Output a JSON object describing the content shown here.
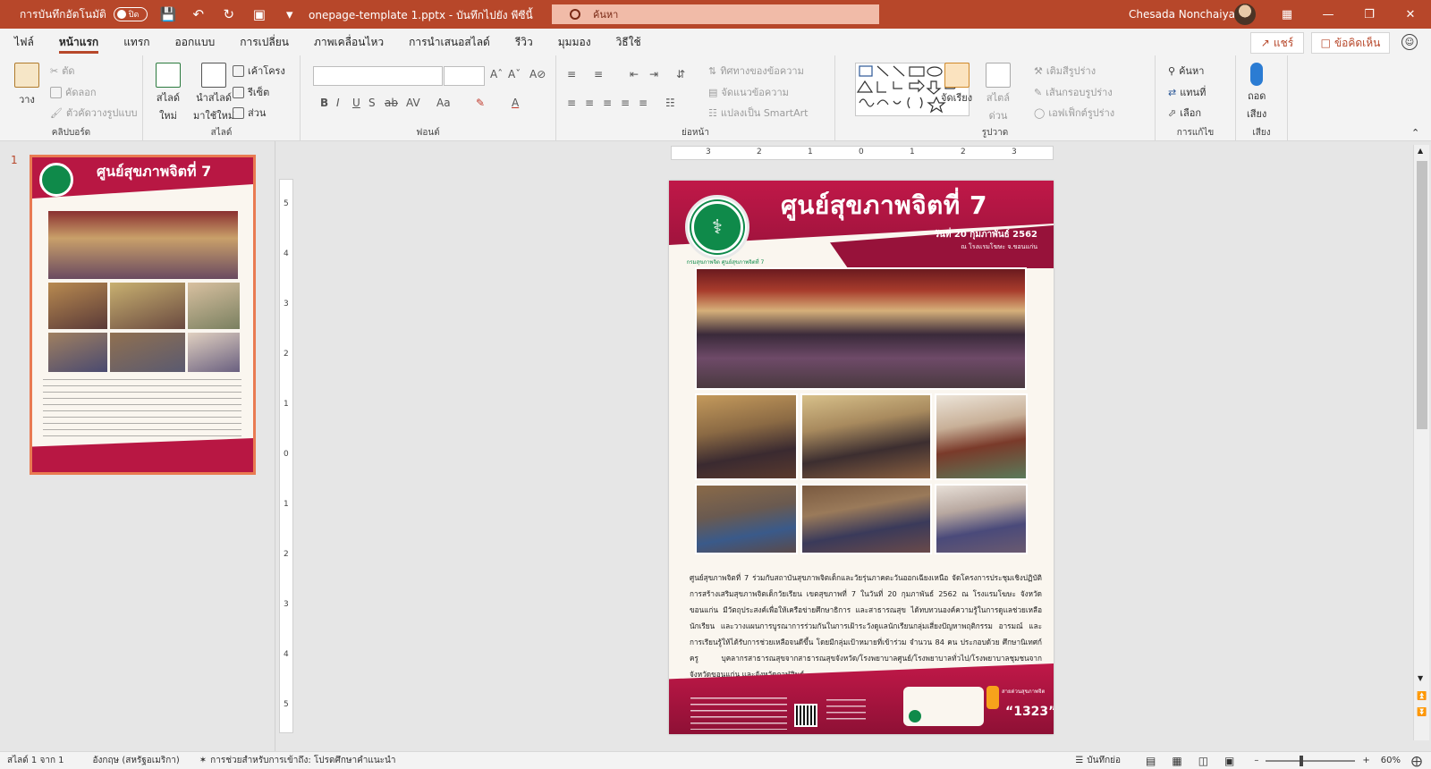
{
  "titlebar": {
    "autosave_label": "การบันทึกอัตโนมัติ",
    "autosave_state": "ปิด",
    "doc_title": "onepage-template 1.pptx - บันทึกไปยัง พีซีนี้",
    "search_placeholder": "ค้นหา",
    "user_name": "Chesada Nonchaiya"
  },
  "tabs": [
    "ไฟล์",
    "หน้าแรก",
    "แทรก",
    "ออกแบบ",
    "การเปลี่ยน",
    "ภาพเคลื่อนไหว",
    "การนำเสนอสไลด์",
    "รีวิว",
    "มุมมอง",
    "วิธีใช้"
  ],
  "active_tab": "หน้าแรก",
  "share_label": "แชร์",
  "comments_label": "ข้อคิดเห็น",
  "ribbon": {
    "clipboard": {
      "paste": "วาง",
      "cut": "ตัด",
      "copy": "คัดลอก",
      "format_painter": "ตัวคัดวางรูปแบบ",
      "label": "คลิปบอร์ด"
    },
    "slides": {
      "new_slide": "สไลด์",
      "new_slide_sub": "ใหม่",
      "reuse": "นำสไลด์",
      "reuse_sub": "มาใช้ใหม่",
      "layout": "เค้าโครง",
      "reset": "รีเซ็ต",
      "section": "ส่วน",
      "label": "สไลด์"
    },
    "font": {
      "label": "ฟอนต์",
      "case": "Aa"
    },
    "paragraph": {
      "label": "ย่อหน้า",
      "text_direction": "ทิศทางของข้อความ",
      "align_text": "จัดแนวข้อความ",
      "smartart": "แปลงเป็น SmartArt"
    },
    "drawing": {
      "arrange": "จัดเรียง",
      "quick_styles": "สไตล์",
      "quick_styles_sub": "ด่วน",
      "fill": "เติมสีรูปร่าง",
      "outline": "เส้นกรอบรูปร่าง",
      "effects": "เอฟเฟ็กต์รูปร่าง",
      "label": "รูปวาด"
    },
    "editing": {
      "find": "ค้นหา",
      "replace": "แทนที่",
      "select": "เลือก",
      "label": "การแก้ไข"
    },
    "voice": {
      "dictate": "ถอด",
      "dictate_sub": "เสียง",
      "label": "เสียง"
    }
  },
  "slide_pane": {
    "slide_number": "1"
  },
  "ruler": {
    "h_ticks": [
      "3",
      "2",
      "1",
      "0",
      "1",
      "2",
      "3"
    ],
    "v_ticks": [
      "5",
      "4",
      "3",
      "2",
      "1",
      "0",
      "1",
      "2",
      "3",
      "4",
      "5"
    ]
  },
  "slide": {
    "title": "ศูนย์สุขภาพจิตที่ 7",
    "date": "วันที่ 20 กุมภาพันธ์ 2562",
    "venue": "ณ โรงแรมโฆษะ จ.ขอนแก่น",
    "logo_caption": "กรมสุขภาพจิต ศูนย์สุขภาพจิตที่ 7 ขอนแก่น",
    "body": "ศูนย์สุขภาพจิตที่ 7 ร่วมกับสถาบันสุขภาพจิตเด็กและวัยรุ่นภาคตะวันออกเฉียงเหนือ จัดโครงการประชุมเชิงปฏิบัติการสร้างเสริมสุขภาพจิตเด็กวัยเรียน เขตสุขภาพที่ 7 ในวันที่ 20 กุมภาพันธ์ 2562 ณ โรงแรมโฆษะ จังหวัดขอนแก่น มีวัตถุประสงค์เพื่อให้เครือข่ายศึกษาธิการ และสาธารณสุข ได้ทบทวนองค์ความรู้ในการดูแลช่วยเหลือนักเรียน และวางแผนการบูรณาการร่วมกันในการเฝ้าระวังดูแลนักเรียนกลุ่มเสี่ยงปัญหาพฤติกรรม อารมณ์ และการเรียนรู้ให้ได้รับการช่วยเหลือจนดีขึ้น โดยมีกลุ่มเป้าหมายที่เข้าร่วม จำนวน 84 คน ประกอบด้วย ศึกษานิเทศก์ ครู บุคลากรสาธารณสุขจากสาธารณสุขจังหวัด/โรงพยาบาลศูนย์/โรงพยาบาลทั่วไป/โรงพยาบาลชุมชนจากจังหวัดขอนแก่น และจังหวัดกาฬสินธุ์",
    "footer_hotline_label": "สายด่วนสุขภาพจิต",
    "hotline": "“1323”"
  },
  "statusbar": {
    "slide_of": "สไลด์ 1 จาก 1",
    "language": "อังกฤษ (สหรัฐอเมริกา)",
    "accessibility": "การช่วยสำหรับการเข้าถึง: โปรดศึกษาคำแนะนำ",
    "notes": "บันทึกย่อ",
    "zoom": "60%"
  }
}
